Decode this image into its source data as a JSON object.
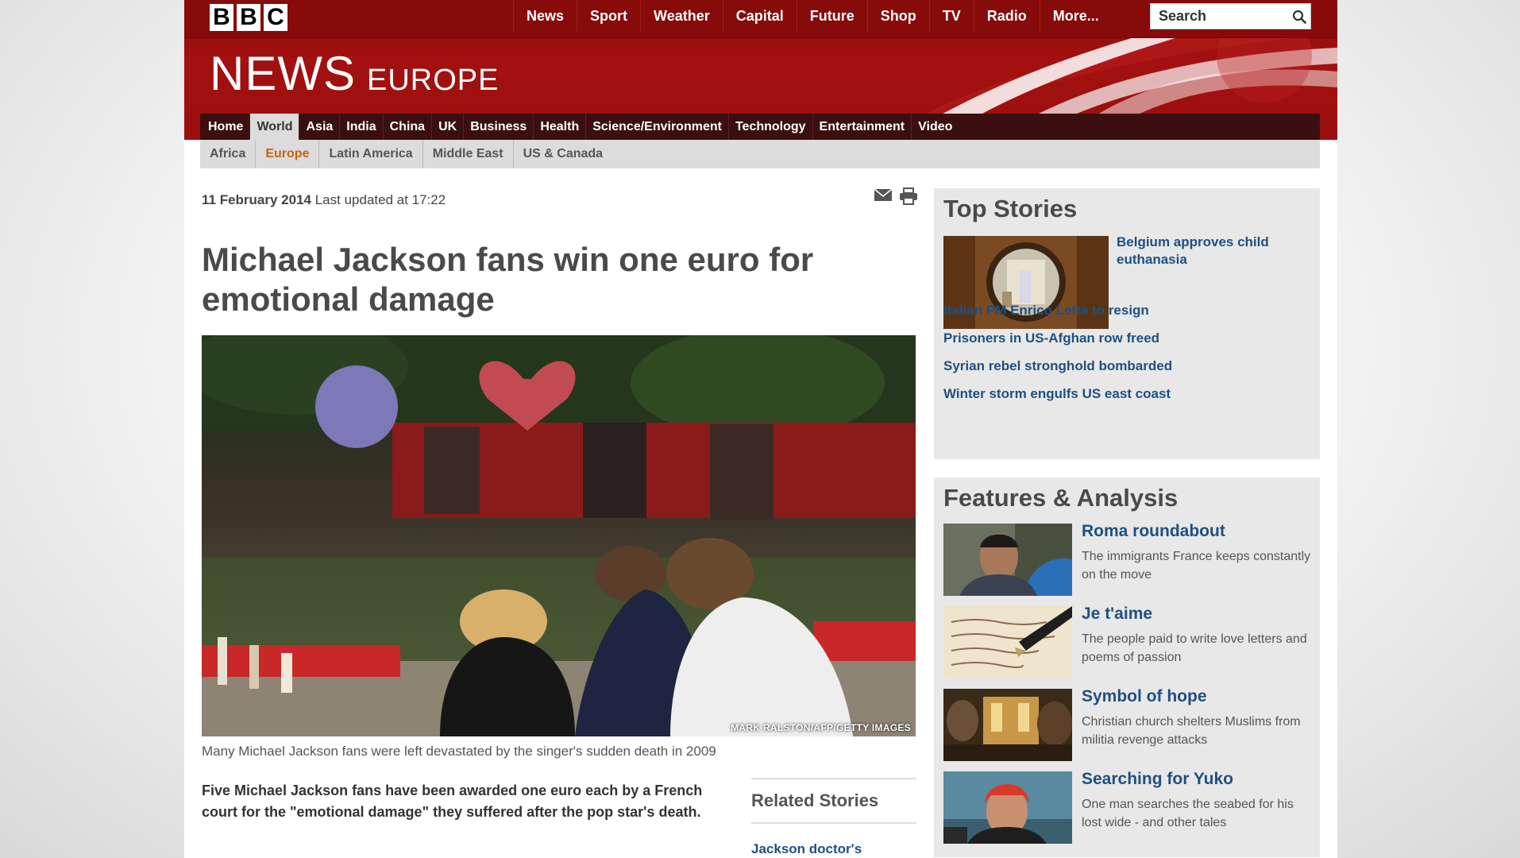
{
  "header": {
    "logo_letters": [
      "B",
      "B",
      "C"
    ],
    "global_nav": [
      "News",
      "Sport",
      "Weather",
      "Capital",
      "Future",
      "Shop",
      "TV",
      "Radio",
      "More..."
    ],
    "search": {
      "placeholder": "Search"
    },
    "title": "NEWS",
    "region": "EUROPE"
  },
  "section_nav": {
    "items": [
      "Home",
      "World",
      "Asia",
      "India",
      "China",
      "UK",
      "Business",
      "Health",
      "Science/Environment",
      "Technology",
      "Entertainment",
      "Video"
    ],
    "active": "World"
  },
  "sub_nav": {
    "items": [
      "Africa",
      "Europe",
      "Latin America",
      "Middle East",
      "US & Canada"
    ],
    "active": "Europe"
  },
  "article": {
    "date": "11 February 2014",
    "updated": "Last updated at 17:22",
    "headline": "Michael Jackson fans win one euro for emotional damage",
    "image_credit": "MARK RALSTON/AFP/GETTY IMAGES",
    "caption": "Many Michael Jackson fans were left devastated by the singer's sudden death in 2009",
    "intro": "Five Michael Jackson fans have been awarded one euro each by a French court for the \"emotional damage\" they suffered after the pop star's death.",
    "related": {
      "title": "Related Stories",
      "links": [
        "Jackson doctor's"
      ]
    }
  },
  "top_stories": {
    "heading": "Top Stories",
    "lead": "Belgium approves child euthanasia",
    "links": [
      "Italian PM Enrico Letta to resign",
      "Prisoners in US-Afghan row freed",
      "Syrian rebel stronghold bombarded",
      "Winter storm engulfs US east coast"
    ]
  },
  "features": {
    "heading": "Features & Analysis",
    "items": [
      {
        "title": "Roma roundabout",
        "summary": "The immigrants France keeps constantly on the move"
      },
      {
        "title": "Je t'aime",
        "summary": "The people paid to write love letters and poems of passion"
      },
      {
        "title": "Symbol of hope",
        "summary": "Christian church shelters Muslims from militia revenge attacks"
      },
      {
        "title": "Searching for Yuko",
        "summary": "One man searches the seabed for his lost wide - and other tales"
      }
    ]
  },
  "icons": [
    "search-icon",
    "email-icon",
    "print-icon"
  ],
  "colors": {
    "brand_red": "#a3100f",
    "nav_dark": "#3b0f0f",
    "link_blue": "#1f4f82",
    "active_orange": "#c8650b",
    "panel_grey": "#e8e8e8"
  }
}
